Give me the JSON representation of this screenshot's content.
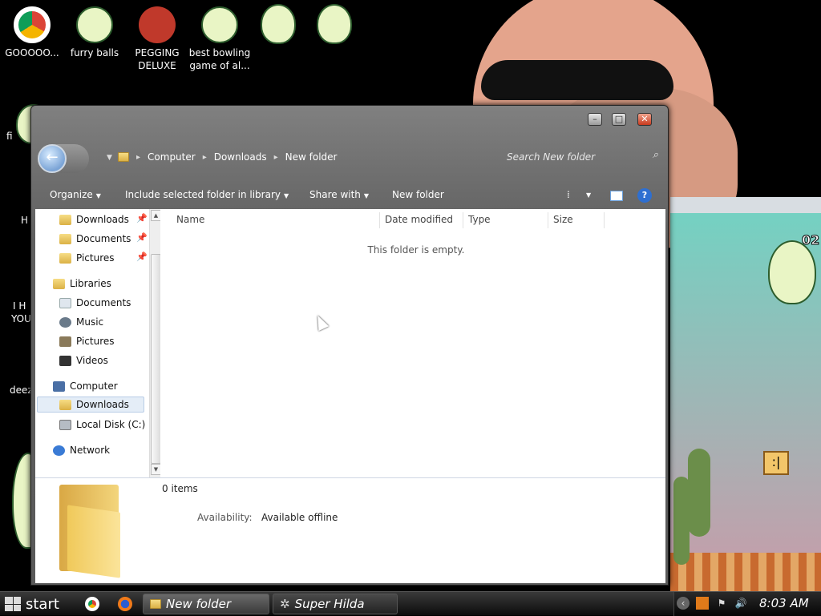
{
  "desktop": {
    "icons": [
      {
        "label": "GOOOOO...",
        "icon": "chrome-icon"
      },
      {
        "label": "furry balls",
        "icon": "app-icon"
      },
      {
        "label": "PEGGING DELUXE",
        "icon": "app-icon"
      },
      {
        "label": "best bowling game of al...",
        "icon": "game-icon"
      }
    ],
    "partial_labels": [
      "fi",
      "H",
      "I H",
      "YOU",
      "deez"
    ],
    "game_window": {
      "score_fragment": "02"
    }
  },
  "explorer": {
    "window_buttons": {
      "minimize": "–",
      "maximize": "□",
      "close": "✕"
    },
    "breadcrumb": [
      "Computer",
      "Downloads",
      "New folder"
    ],
    "search_placeholder": "Search New folder",
    "toolbar": {
      "organize": "Organize",
      "include": "Include selected folder in library",
      "share": "Share with",
      "new_folder": "New folder"
    },
    "nav": {
      "favorites": [
        {
          "label": "Downloads",
          "icon": "downloads-folder-icon"
        },
        {
          "label": "Documents",
          "icon": "documents-folder-icon"
        },
        {
          "label": "Pictures",
          "icon": "pictures-folder-icon"
        }
      ],
      "libraries": {
        "label": "Libraries",
        "items": [
          {
            "label": "Documents",
            "icon": "documents-library-icon"
          },
          {
            "label": "Music",
            "icon": "music-library-icon"
          },
          {
            "label": "Pictures",
            "icon": "pictures-library-icon"
          },
          {
            "label": "Videos",
            "icon": "videos-library-icon"
          }
        ]
      },
      "computer": {
        "label": "Computer",
        "items": [
          {
            "label": "Downloads",
            "icon": "downloads-folder-icon",
            "selected": true
          },
          {
            "label": "Local Disk (C:)",
            "icon": "disk-icon"
          }
        ]
      },
      "network": {
        "label": "Network"
      }
    },
    "columns": [
      "Name",
      "Date modified",
      "Type",
      "Size"
    ],
    "empty_message": "This folder is empty.",
    "details": {
      "count": "0 items",
      "availability_label": "Availability:",
      "availability_value": "Available offline"
    }
  },
  "taskbar": {
    "start_label": "start",
    "tasks": [
      {
        "label": "New folder",
        "active": true
      },
      {
        "label": "Super Hilda",
        "active": false
      }
    ],
    "clock": "8:03 AM"
  }
}
